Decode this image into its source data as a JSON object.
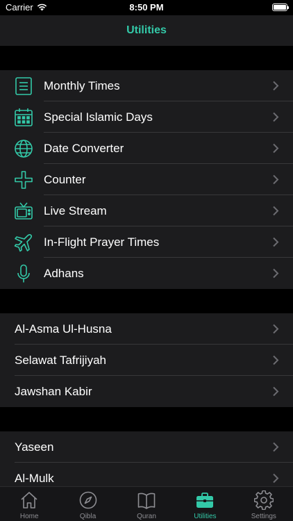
{
  "status_bar": {
    "carrier": "Carrier",
    "time": "8:50 PM"
  },
  "nav": {
    "title": "Utilities"
  },
  "sections": [
    {
      "rows": [
        {
          "label": "Monthly Times",
          "icon": "document-list-icon"
        },
        {
          "label": "Special Islamic Days",
          "icon": "calendar-icon"
        },
        {
          "label": "Date Converter",
          "icon": "globe-icon"
        },
        {
          "label": "Counter",
          "icon": "plus-icon"
        },
        {
          "label": "Live Stream",
          "icon": "tv-icon"
        },
        {
          "label": "In-Flight Prayer Times",
          "icon": "airplane-icon"
        },
        {
          "label": "Adhans",
          "icon": "microphone-icon"
        }
      ]
    },
    {
      "rows": [
        {
          "label": "Al-Asma Ul-Husna"
        },
        {
          "label": "Selawat Tafrijiyah"
        },
        {
          "label": "Jawshan Kabir"
        }
      ]
    },
    {
      "rows": [
        {
          "label": "Yaseen"
        },
        {
          "label": "Al-Mulk"
        }
      ]
    }
  ],
  "tabs": [
    {
      "label": "Home",
      "icon": "home-icon",
      "active": false
    },
    {
      "label": "Qibla",
      "icon": "compass-icon",
      "active": false
    },
    {
      "label": "Quran",
      "icon": "book-icon",
      "active": false
    },
    {
      "label": "Utilities",
      "icon": "briefcase-icon",
      "active": true
    },
    {
      "label": "Settings",
      "icon": "gear-icon",
      "active": false
    }
  ],
  "colors": {
    "accent": "#33c9a8",
    "background": "#000000",
    "cell": "#1c1c1e",
    "separator": "#38383a",
    "inactive": "#8e8e93"
  }
}
